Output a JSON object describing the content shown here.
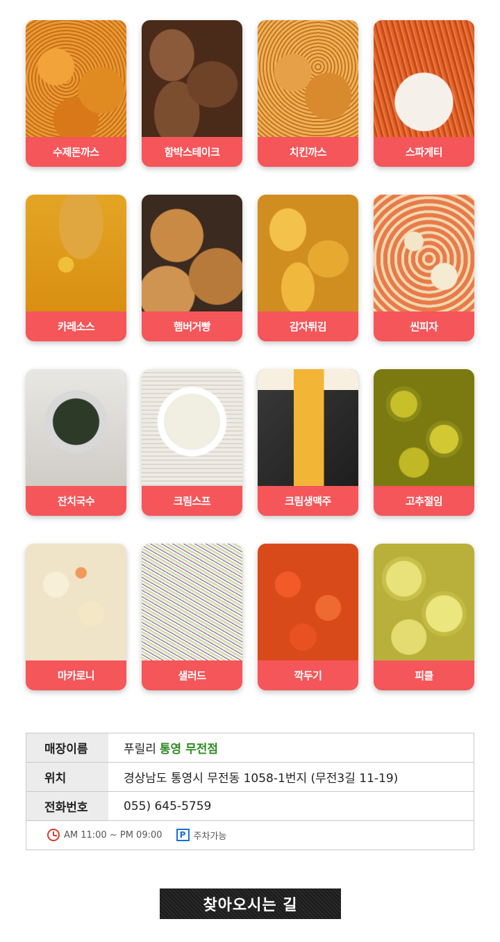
{
  "menu": {
    "rows": [
      [
        {
          "label": "수제돈까스",
          "photo": "p-cutlet"
        },
        {
          "label": "함박스테이크",
          "photo": "p-steak"
        },
        {
          "label": "치킨까스",
          "photo": "p-chicken"
        },
        {
          "label": "스파게티",
          "photo": "p-spaghetti"
        }
      ],
      [
        {
          "label": "카레소스",
          "photo": "p-curry"
        },
        {
          "label": "햄버거빵",
          "photo": "p-burger"
        },
        {
          "label": "감자튀김",
          "photo": "p-fries"
        },
        {
          "label": "씬피자",
          "photo": "p-pizza"
        }
      ],
      [
        {
          "label": "잔치국수",
          "photo": "p-noodle"
        },
        {
          "label": "크림스프",
          "photo": "p-soup"
        },
        {
          "label": "크림생맥주",
          "photo": "p-beer"
        },
        {
          "label": "고추절임",
          "photo": "p-jalapeno"
        }
      ],
      [
        {
          "label": "마카로니",
          "photo": "p-macaroni"
        },
        {
          "label": "샐러드",
          "photo": "p-salad"
        },
        {
          "label": "깍두기",
          "photo": "p-kkakdugi"
        },
        {
          "label": "피클",
          "photo": "p-pickle"
        }
      ]
    ],
    "label_color": "#f4565a"
  },
  "store": {
    "name_key": "매장이름",
    "name_prefix": "푸릴리",
    "name_highlight": "통영 무전점",
    "location_key": "위치",
    "location_value": "경상남도 통영시 무전동 1058-1번지 (무전3길 11-19)",
    "phone_key": "전화번호",
    "phone_value": "055) 645-5759",
    "hours": "AM 11:00 ~ PM 09:00",
    "hours_icon": "clock-icon",
    "parking_badge": "P",
    "parking": "주차가능",
    "highlight_color": "#2e8a22"
  },
  "directions_button": "찾아오시는 길"
}
